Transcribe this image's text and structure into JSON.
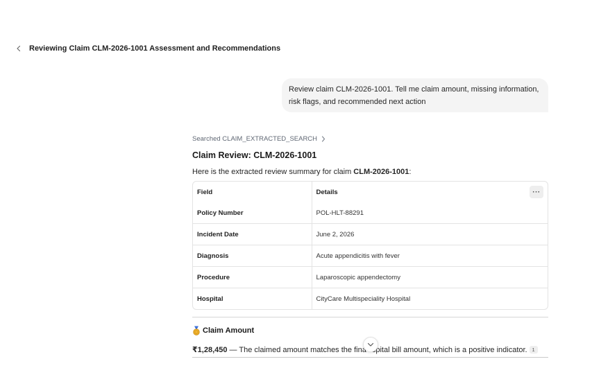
{
  "header": {
    "title": "Reviewing Claim CLM-2026-1001 Assessment and Recommendations",
    "back_icon": "chevron-left-icon"
  },
  "user_message": {
    "text": "Review claim CLM-2026-1001. Tell me claim amount, missing information, risk flags, and recommended next action"
  },
  "response": {
    "tool_call_label": "Searched CLAIM_EXTRACTED_SEARCH",
    "title": "Claim Review: CLM-2026-1001",
    "intro_prefix": "Here is the extracted review summary for claim ",
    "intro_claim_id": "CLM-2026-1001",
    "intro_suffix": ":",
    "table": {
      "headers": [
        "Field",
        "Details"
      ],
      "more_label": "···",
      "rows": [
        {
          "field": "Policy Number",
          "value": "POL-HLT-88291"
        },
        {
          "field": "Incident Date",
          "value": "June 2, 2026"
        },
        {
          "field": "Diagnosis",
          "value": "Acute appendicitis with fever"
        },
        {
          "field": "Procedure",
          "value": "Laparoscopic appendectomy"
        },
        {
          "field": "Hospital",
          "value": "CityCare Multispeciality Hospital"
        }
      ]
    },
    "claim_amount": {
      "icon": "medal-icon",
      "heading": "Claim Amount",
      "amount": "₹1,28,450",
      "text_before_overlap": " — The claimed amount matches the fina",
      "text_after_overlap": "spital bill amount, which is a positive indicator.",
      "citation": "1"
    }
  },
  "colors": {
    "bubble_bg": "#f4f4f4",
    "border": "#e3e3e3",
    "muted_text": "#5f6773"
  }
}
